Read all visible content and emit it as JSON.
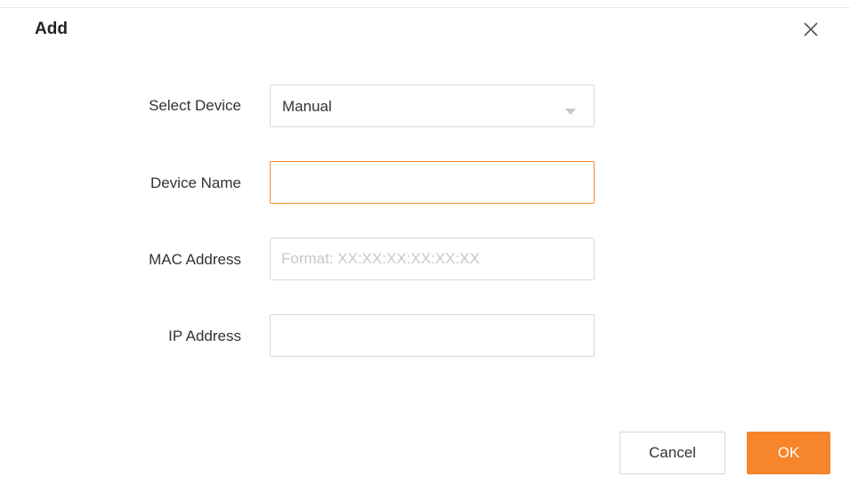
{
  "dialog": {
    "title": "Add"
  },
  "form": {
    "select_device": {
      "label": "Select Device",
      "value": "Manual"
    },
    "device_name": {
      "label": "Device Name",
      "value": ""
    },
    "mac_address": {
      "label": "MAC Address",
      "value": "",
      "placeholder": "Format: XX:XX:XX:XX:XX:XX"
    },
    "ip_address": {
      "label": "IP Address",
      "value": ""
    }
  },
  "buttons": {
    "cancel_label": "Cancel",
    "ok_label": "OK"
  },
  "icons": {
    "close": "close-icon",
    "dropdown": "triangle-down-icon"
  },
  "colors": {
    "accent": "#f6852b",
    "focus_border": "#f38b35",
    "border": "#d9d9d9",
    "placeholder": "#c8c8c8"
  }
}
